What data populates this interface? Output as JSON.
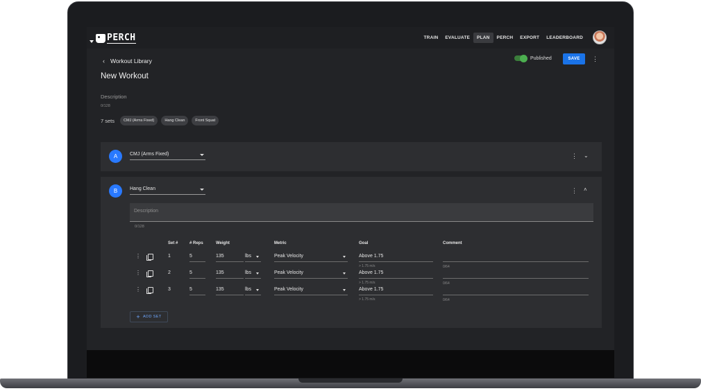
{
  "app": {
    "logo": "PERCH"
  },
  "nav": {
    "items": [
      "TRAIN",
      "EVALUATE",
      "PLAN",
      "PERCH",
      "EXPORT",
      "LEADERBOARD"
    ],
    "active": "PLAN"
  },
  "header": {
    "back_label": "Workout Library",
    "title": "New Workout",
    "published_label": "Published",
    "published": true,
    "save_label": "SAVE"
  },
  "description": {
    "label": "Description",
    "count": "0/128"
  },
  "sets_summary": {
    "label": "7 sets",
    "chips": [
      "CMJ (Arms Fixed)",
      "Hang Clean",
      "Front Squat"
    ]
  },
  "blocks": [
    {
      "letter": "A",
      "exercise": "CMJ (Arms Fixed)",
      "expanded": false
    },
    {
      "letter": "B",
      "exercise": "Hang Clean",
      "expanded": true,
      "description_placeholder": "Description",
      "description_count": "0/128",
      "columns": [
        "Set #",
        "# Reps",
        "Weight",
        "Metric",
        "Goal",
        "Comment"
      ],
      "rows": [
        {
          "set": "1",
          "reps": "5",
          "weight": "135",
          "unit": "lbs",
          "metric": "Peak Velocity",
          "goal": "Above 1.75",
          "goal_hint": "> 1.75 m/s",
          "comment_count": "0/64"
        },
        {
          "set": "2",
          "reps": "5",
          "weight": "135",
          "unit": "lbs",
          "metric": "Peak Velocity",
          "goal": "Above 1.75",
          "goal_hint": "> 1.75 m/s",
          "comment_count": "0/64"
        },
        {
          "set": "3",
          "reps": "5",
          "weight": "135",
          "unit": "lbs",
          "metric": "Peak Velocity",
          "goal": "Above 1.75",
          "goal_hint": "> 1.75 m/s",
          "comment_count": "0/64"
        }
      ],
      "add_set_label": "ADD SET"
    }
  ],
  "colors": {
    "accent": "#1a73e8",
    "circle": "#2979ff",
    "toggle": "#4caf50",
    "background": "#222326"
  }
}
